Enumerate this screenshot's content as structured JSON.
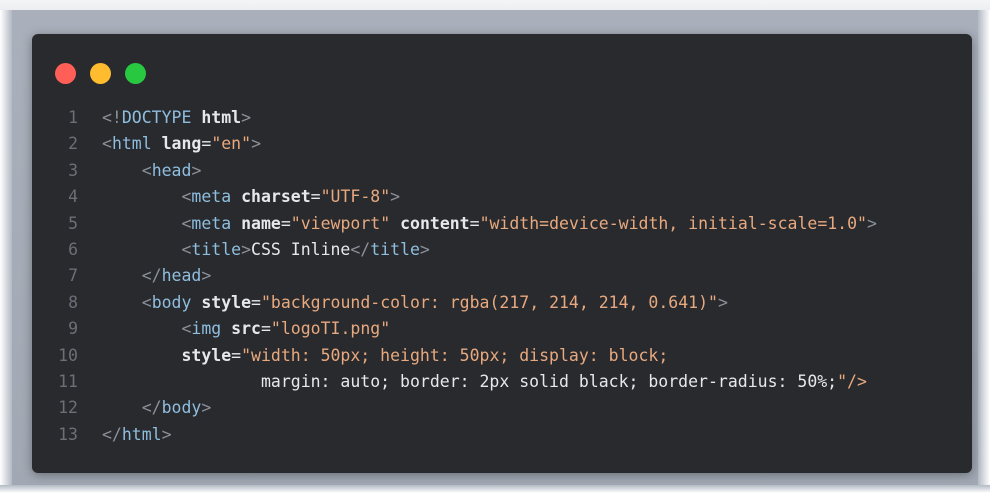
{
  "window": {
    "buttons": [
      "close",
      "minimize",
      "maximize"
    ],
    "colors": {
      "close": "#ff5f57",
      "minimize": "#febc2e",
      "maximize": "#28c840",
      "background": "#282a2e"
    }
  },
  "code": {
    "language": "html",
    "lines": [
      {
        "n": "1",
        "text": "<!DOCTYPE html>"
      },
      {
        "n": "2",
        "text": "<html lang=\"en\">"
      },
      {
        "n": "3",
        "text": "    <head>"
      },
      {
        "n": "4",
        "text": "        <meta charset=\"UTF-8\">"
      },
      {
        "n": "5",
        "text": "        <meta name=\"viewport\" content=\"width=device-width, initial-scale=1.0\">"
      },
      {
        "n": "6",
        "text": "        <title>CSS Inline</title>"
      },
      {
        "n": "7",
        "text": "    </head>"
      },
      {
        "n": "8",
        "text": "    <body style=\"background-color: rgba(217, 214, 214, 0.641)\">"
      },
      {
        "n": "9",
        "text": "        <img src=\"logoTI.png\""
      },
      {
        "n": "10",
        "text": "        style=\"width: 50px; height: 50px; display: block;"
      },
      {
        "n": "11",
        "text": "                margin: auto; border: 2px solid black; border-radius: 50%;\"/>"
      },
      {
        "n": "12",
        "text": "    </body>"
      },
      {
        "n": "13",
        "text": "</html>"
      }
    ]
  }
}
